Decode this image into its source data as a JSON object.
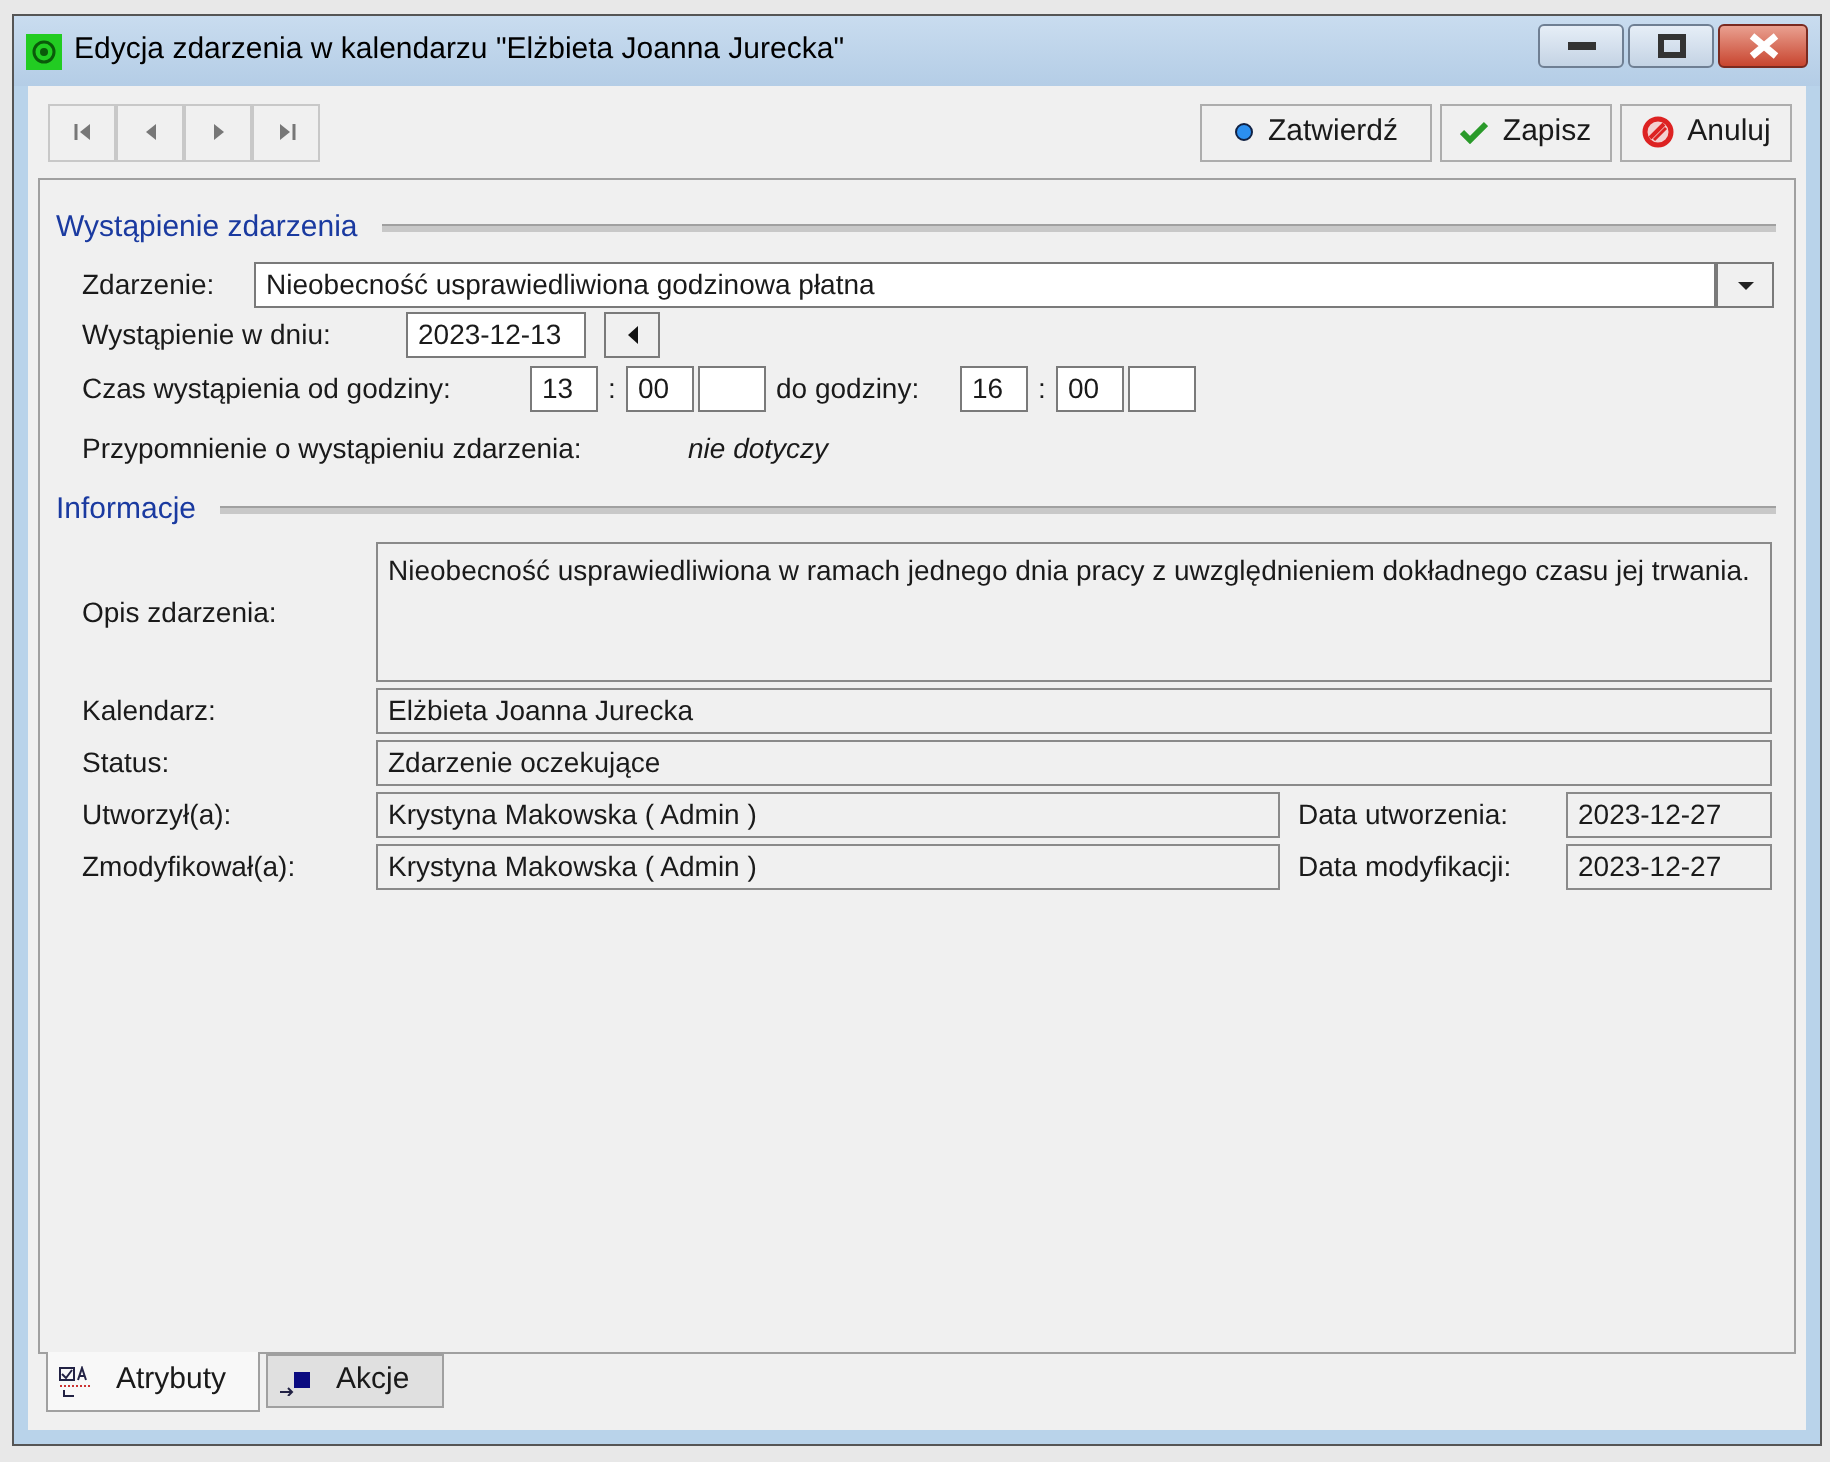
{
  "window": {
    "title": "Edycja zdarzenia w kalendarzu \"Elżbieta Joanna Jurecka\""
  },
  "actions": [
    {
      "kind": "confirm",
      "label": "Zatwierdź"
    },
    {
      "kind": "save",
      "label": "Zapisz"
    },
    {
      "kind": "cancel",
      "label": "Anuluj"
    }
  ],
  "occurrence": {
    "heading": "Wystąpienie zdarzenia",
    "event_label": "Zdarzenie:",
    "event_value": "Nieobecność usprawiedliwiona godzinowa płatna",
    "date_label": "Wystąpienie w dniu:",
    "date_value": "2023-12-13",
    "time_label": "Czas wystąpienia od godziny:",
    "from_hour": "13",
    "from_sep": ":",
    "from_minute": "00",
    "to_label": "do godziny:",
    "to_hour": "16",
    "to_sep": ":",
    "to_minute": "00",
    "reminder_label": "Przypomnienie o wystąpieniu zdarzenia:",
    "reminder_value": "nie dotyczy"
  },
  "information": {
    "heading": "Informacje",
    "description_label": "Opis zdarzenia:",
    "description": "Nieobecność usprawiedliwiona w ramach jednego dnia pracy z uwzględnieniem dokładnego czasu jej trwania.",
    "calendar_label": "Kalendarz:",
    "calendar": "Elżbieta Joanna Jurecka",
    "status_label": "Status:",
    "status": "Zdarzenie oczekujące",
    "created_by_label": "Utworzył(a):",
    "created_by": "Krystyna Makowska ( Admin )",
    "created_date_label": "Data utworzenia:",
    "created_date": "2023-12-27",
    "modified_by_label": "Zmodyfikował(a):",
    "modified_by": "Krystyna Makowska ( Admin )",
    "modified_date_label": "Data modyfikacji:",
    "modified_date": "2023-12-27"
  },
  "tabs": [
    {
      "label": "Atrybuty",
      "selected": true
    },
    {
      "label": "Akcje",
      "selected": false
    }
  ]
}
